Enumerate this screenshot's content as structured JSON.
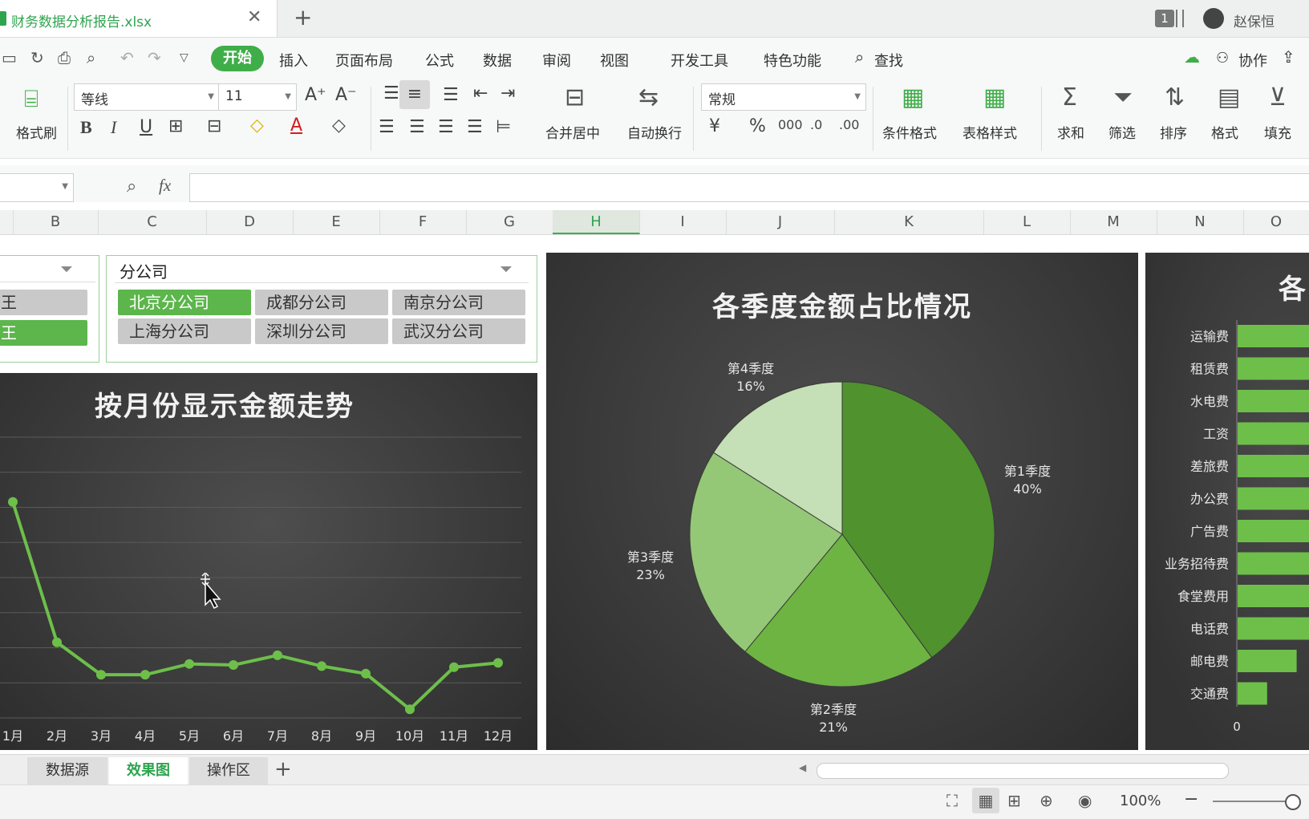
{
  "titlebar": {
    "file_name": "财务数据分析报告.xlsx",
    "close_glyph": "✕",
    "new_tab_glyph": "+",
    "badge": "1",
    "user": "赵保恒"
  },
  "menu": {
    "items": [
      "开始",
      "插入",
      "页面布局",
      "公式",
      "数据",
      "审阅",
      "视图",
      "开发工具",
      "特色功能"
    ],
    "search": "查找",
    "collab": "协作"
  },
  "ribbon": {
    "format_painter": "格式刷",
    "font_name": "等线",
    "font_size": "11",
    "bold": "B",
    "italic": "I",
    "underline": "U",
    "merge_center": "合并居中",
    "wrap_text": "自动换行",
    "number_format": "常规",
    "conditional_format": "条件格式",
    "table_style": "表格样式",
    "sum": "求和",
    "filter": "筛选",
    "sort": "排序",
    "format": "格式",
    "fill": "填充"
  },
  "formula_bar": {
    "fx": "fx",
    "value": ""
  },
  "columns": [
    "B",
    "C",
    "D",
    "E",
    "F",
    "G",
    "H",
    "I",
    "J",
    "K",
    "L",
    "M",
    "N",
    "O"
  ],
  "selected_column": "H",
  "slicer_left": {
    "items": [
      "王",
      "王"
    ]
  },
  "slicer_branch": {
    "title": "分公司",
    "items": [
      {
        "label": "北京分公司",
        "selected": true
      },
      {
        "label": "成都分公司",
        "selected": false
      },
      {
        "label": "南京分公司",
        "selected": false
      },
      {
        "label": "上海分公司",
        "selected": false
      },
      {
        "label": "深圳分公司",
        "selected": false
      },
      {
        "label": "武汉分公司",
        "selected": false
      }
    ]
  },
  "colors": {
    "accent": "#3fae49",
    "line": "#6dbf4a",
    "chart_bg": "#3a3a3a"
  },
  "chart_data": [
    {
      "type": "line",
      "title": "按月份显示金额走势",
      "categories": [
        "1月",
        "2月",
        "3月",
        "4月",
        "5月",
        "6月",
        "7月",
        "8月",
        "9月",
        "10月",
        "11月",
        "12月"
      ],
      "series": [
        {
          "values": [
            100,
            35,
            20,
            20,
            25,
            24.5,
            29,
            24,
            20.5,
            4,
            23.5,
            25.5
          ]
        }
      ],
      "ylim": [
        0,
        130
      ],
      "grid": true
    },
    {
      "type": "pie",
      "title": "各季度金额占比情况",
      "slices": [
        {
          "label": "第1季度",
          "value": 40,
          "pct": "40%",
          "color": "#4f922e"
        },
        {
          "label": "第2季度",
          "value": 21,
          "pct": "21%",
          "color": "#6db443"
        },
        {
          "label": "第3季度",
          "value": 23,
          "pct": "23%",
          "color": "#94c877"
        },
        {
          "label": "第4季度",
          "value": 16,
          "pct": "16%",
          "color": "#c5dfb6"
        }
      ]
    },
    {
      "type": "bar",
      "title": "各",
      "categories": [
        "运输费",
        "租赁费",
        "水电费",
        "工资",
        "差旅费",
        "办公费",
        "广告费",
        "业务招待费",
        "食堂费用",
        "电话费",
        "邮电费",
        "交通费"
      ],
      "values": [
        30000,
        30000,
        30000,
        30000,
        30000,
        30000,
        30000,
        30000,
        24000,
        20000,
        8000,
        4000
      ],
      "xticks": [
        "0",
        "20000"
      ],
      "xlim": [
        0,
        40000
      ]
    }
  ],
  "sheets": [
    {
      "label": "数据源",
      "active": false
    },
    {
      "label": "效果图",
      "active": true
    },
    {
      "label": "操作区",
      "active": false
    }
  ],
  "add_sheet": "+",
  "status": {
    "zoom": "100%"
  }
}
